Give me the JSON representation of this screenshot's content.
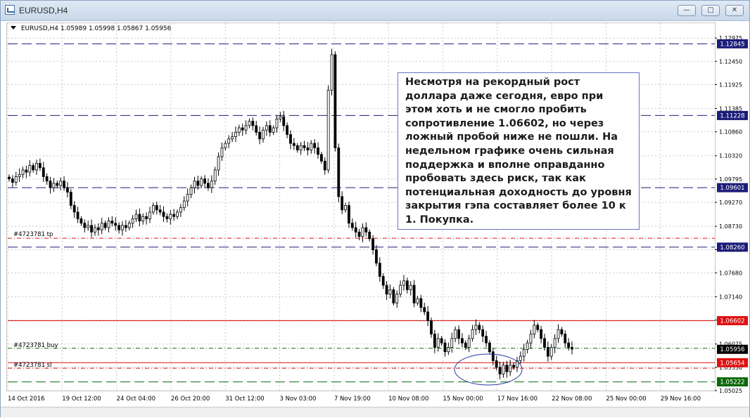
{
  "window": {
    "title": "EURUSD,H4"
  },
  "header": {
    "symbol": "EURUSD,H4",
    "ohlc": "1.05989 1.05998 1.05867 1.05956"
  },
  "annotation": {
    "text": "Несмотря на рекордный рост доллара даже сегодня, евро при этом хоть и не смогло пробить сопротивление 1.06602, но через ложный пробой ниже не пошли. На недельном графике очень сильная поддержка и вполне оправданно пробовать здесь риск, так как потенциальная доходность до уровня закрытия гэпа составляет более 10 к 1. Покупка."
  },
  "orders": {
    "tp_label": "#4723781 tp",
    "buy_label": "#4723781 buy",
    "sl_label": "#4723781 sl"
  },
  "colors": {
    "navy": "#1c1c7a",
    "red": "#e01010",
    "green": "#0a6a0a",
    "grid": "#c8c8c8",
    "candle": "#000000",
    "ellipse": "#2a3aa0"
  },
  "chart_data": {
    "type": "candlestick",
    "symbol": "EURUSD",
    "timeframe": "H4",
    "ylim": [
      1.05025,
      1.1331
    ],
    "y_ticks": [
      "1.12975",
      "1.12450",
      "1.11925",
      "1.11385",
      "1.10860",
      "1.10320",
      "1.09795",
      "1.09270",
      "1.08730",
      "1.08205",
      "1.07680",
      "1.07140",
      "1.06615",
      "1.06075",
      "1.05550",
      "1.05025"
    ],
    "x_ticks": [
      "14 Oct 2016",
      "19 Oct 12:00",
      "24 Oct 04:00",
      "26 Oct 20:00",
      "31 Oct 12:00",
      "3 Nov 03:00",
      "7 Nov 19:00",
      "10 Nov 08:00",
      "15 Nov 00:00",
      "17 Nov 16:00",
      "22 Nov 08:00",
      "25 Nov 00:00",
      "29 Nov 16:00"
    ],
    "levels": [
      {
        "price": 1.12845,
        "label": "1.12845",
        "color": "#1c1c7a",
        "style": "dashed"
      },
      {
        "price": 1.11228,
        "label": "1.11228",
        "color": "#1c1c7a",
        "style": "dashed"
      },
      {
        "price": 1.09601,
        "label": "1.09601",
        "color": "#1c1c7a",
        "style": "dashed"
      },
      {
        "price": 1.0826,
        "label": "1.08260",
        "color": "#1c1c7a",
        "style": "dashed"
      },
      {
        "price": 1.06602,
        "label": "1.06602",
        "color": "#e01010",
        "style": "solid"
      },
      {
        "price": 1.05956,
        "label": "1.05956",
        "color": "#000000",
        "style": "current"
      },
      {
        "price": 1.05654,
        "label": "1.05654",
        "color": "#e01010",
        "style": "solid"
      },
      {
        "price": 1.05222,
        "label": "1.05222",
        "color": "#0a6a0a",
        "style": "dashed"
      }
    ],
    "order_lines": [
      {
        "price": 1.0846,
        "label": "#4723781 tp",
        "color": "#e01010",
        "style": "dashdot"
      },
      {
        "price": 1.0598,
        "label": "#4723781 buy",
        "color": "#0a6a0a",
        "style": "dashdot"
      },
      {
        "price": 1.0553,
        "label": "#4723781 sl",
        "color": "#e01010",
        "style": "dashdot"
      }
    ],
    "series_close": [
      1.098,
      1.0972,
      1.0985,
      1.099,
      1.1,
      1.0995,
      1.101,
      1.1,
      1.1015,
      1.1005,
      1.0985,
      1.0975,
      1.096,
      1.097,
      1.0965,
      1.0975,
      1.096,
      1.095,
      1.092,
      1.0905,
      1.089,
      1.088,
      1.087,
      1.0875,
      1.086,
      1.087,
      1.0865,
      1.088,
      1.087,
      1.0885,
      1.088,
      1.0875,
      1.0865,
      1.0875,
      1.087,
      1.088,
      1.089,
      1.09,
      1.0885,
      1.0895,
      1.089,
      1.0905,
      1.092,
      1.091,
      1.0905,
      1.0895,
      1.089,
      1.09,
      1.0895,
      1.0905,
      1.0915,
      1.093,
      1.0945,
      1.096,
      1.0975,
      1.0965,
      1.098,
      1.097,
      1.096,
      1.0975,
      1.1,
      1.103,
      1.105,
      1.106,
      1.107,
      1.1075,
      1.1085,
      1.1095,
      1.109,
      1.11,
      1.111,
      1.11,
      1.1085,
      1.107,
      1.109,
      1.11,
      1.1085,
      1.1095,
      1.1115,
      1.112,
      1.11,
      1.108,
      1.106,
      1.1055,
      1.1045,
      1.1055,
      1.105,
      1.1045,
      1.106,
      1.105,
      1.1035,
      1.102,
      1.1,
      1.118,
      1.126,
      1.105,
      1.094,
      1.091,
      1.092,
      1.088,
      1.087,
      1.086,
      1.085,
      1.087,
      1.086,
      1.0845,
      1.082,
      1.079,
      1.076,
      1.074,
      1.072,
      1.073,
      1.07,
      1.072,
      1.074,
      1.075,
      1.073,
      1.074,
      1.07,
      1.071,
      1.069,
      1.068,
      1.066,
      1.063,
      1.06,
      1.062,
      1.061,
      1.059,
      1.06,
      1.062,
      1.064,
      1.062,
      1.061,
      1.06,
      1.062,
      1.064,
      1.065,
      1.064,
      1.0625,
      1.061,
      1.059,
      1.057,
      1.0555,
      1.054,
      1.056,
      1.0545,
      1.056,
      1.0555,
      1.057,
      1.058,
      1.0595,
      1.061,
      1.063,
      1.065,
      1.064,
      1.062,
      1.06,
      1.058,
      1.06,
      1.062,
      1.064,
      1.063,
      1.061,
      1.06,
      1.0596
    ]
  }
}
